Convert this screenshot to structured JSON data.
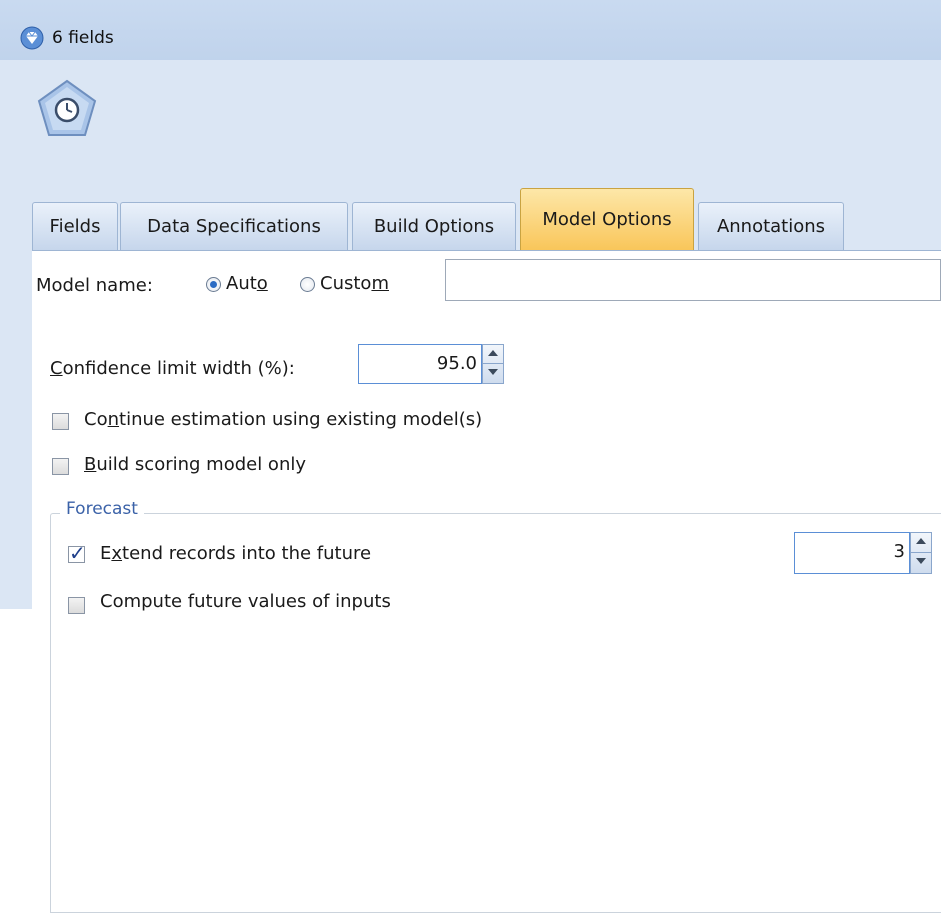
{
  "window": {
    "title": "6 fields"
  },
  "tabs": [
    {
      "label": "Fields"
    },
    {
      "label": "Data Specifications"
    },
    {
      "label": "Build Options"
    },
    {
      "label": "Model Options",
      "active": true
    },
    {
      "label": "Annotations"
    }
  ],
  "model_name": {
    "label": "Model name:",
    "auto": {
      "label_pre": "Aut",
      "label_ul": "o",
      "label_post": "",
      "selected": true
    },
    "custom": {
      "label_pre": "Custo",
      "label_ul": "m",
      "label_post": "",
      "selected": false
    },
    "value": ""
  },
  "confidence": {
    "label_ul": "C",
    "label_post": "onfidence limit width (%):",
    "value": "95.0"
  },
  "continue_estimation": {
    "label_pre": "Co",
    "label_ul": "n",
    "label_post": "tinue estimation using existing model(s)",
    "checked": false
  },
  "build_scoring": {
    "label_pre": "",
    "label_ul": "B",
    "label_post": "uild scoring model only",
    "checked": false
  },
  "forecast": {
    "legend": "Forecast",
    "extend": {
      "label_pre": "E",
      "label_ul": "x",
      "label_post": "tend records into the future",
      "checked": true,
      "value": "3"
    },
    "compute": {
      "label": "Compute future values of inputs",
      "checked": false
    }
  },
  "colors": {
    "active_tab": "#f9c65a",
    "titlebar": "#c9daf0",
    "accent": "#2a6bc4"
  }
}
